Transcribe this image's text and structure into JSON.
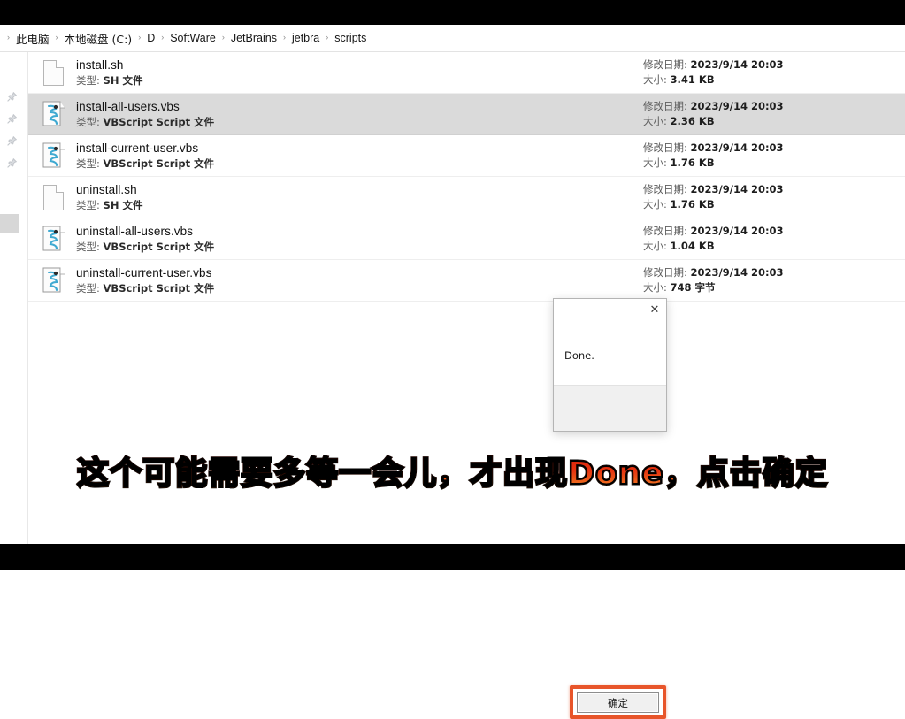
{
  "window": {
    "breadcrumb": {
      "name": "breadcrumb",
      "leading_chevron": "›",
      "separator": "›",
      "items": [
        {
          "label": "此电脑"
        },
        {
          "label": "本地磁盘 (C:)"
        },
        {
          "label": "D"
        },
        {
          "label": "SoftWare"
        },
        {
          "label": "JetBrains"
        },
        {
          "label": "jetbra"
        },
        {
          "label": "scripts"
        }
      ]
    },
    "rail": {
      "pin_icon": "pin-icon",
      "pin_count": 4
    },
    "labels": {
      "date_prefix": "修改日期:",
      "size_prefix": "大小:"
    },
    "files": [
      {
        "name": "install.sh",
        "type_label": "类型:",
        "type_value": "SH 文件",
        "icon": "sh-file-icon",
        "modified": "2023/9/14 20:03",
        "size": "3.41 KB",
        "selected": false
      },
      {
        "name": "install-all-users.vbs",
        "type_label": "类型:",
        "type_value": "VBScript Script 文件",
        "icon": "vbs-file-icon",
        "modified": "2023/9/14 20:03",
        "size": "2.36 KB",
        "selected": true
      },
      {
        "name": "install-current-user.vbs",
        "type_label": "类型:",
        "type_value": "VBScript Script 文件",
        "icon": "vbs-file-icon",
        "modified": "2023/9/14 20:03",
        "size": "1.76 KB",
        "selected": false
      },
      {
        "name": "uninstall.sh",
        "type_label": "类型:",
        "type_value": "SH 文件",
        "icon": "sh-file-icon",
        "modified": "2023/9/14 20:03",
        "size": "1.76 KB",
        "selected": false
      },
      {
        "name": "uninstall-all-users.vbs",
        "type_label": "类型:",
        "type_value": "VBScript Script 文件",
        "icon": "vbs-file-icon",
        "modified": "2023/9/14 20:03",
        "size": "1.04 KB",
        "selected": false
      },
      {
        "name": "uninstall-current-user.vbs",
        "type_label": "类型:",
        "type_value": "VBScript Script 文件",
        "icon": "vbs-file-icon",
        "modified": "2023/9/14 20:03",
        "size": "748 字节",
        "selected": false
      }
    ]
  },
  "dialog": {
    "close_icon": "✕",
    "message": "Done.",
    "ok_label": "确定",
    "highlight_color": "#e8552a"
  },
  "subtitle": {
    "text": "这个可能需要多等一会儿，才出现Done，点击确定",
    "fill_top_color": "#d81f09",
    "fill_bottom_color": "#f5882c",
    "stroke_color": "#000000"
  }
}
